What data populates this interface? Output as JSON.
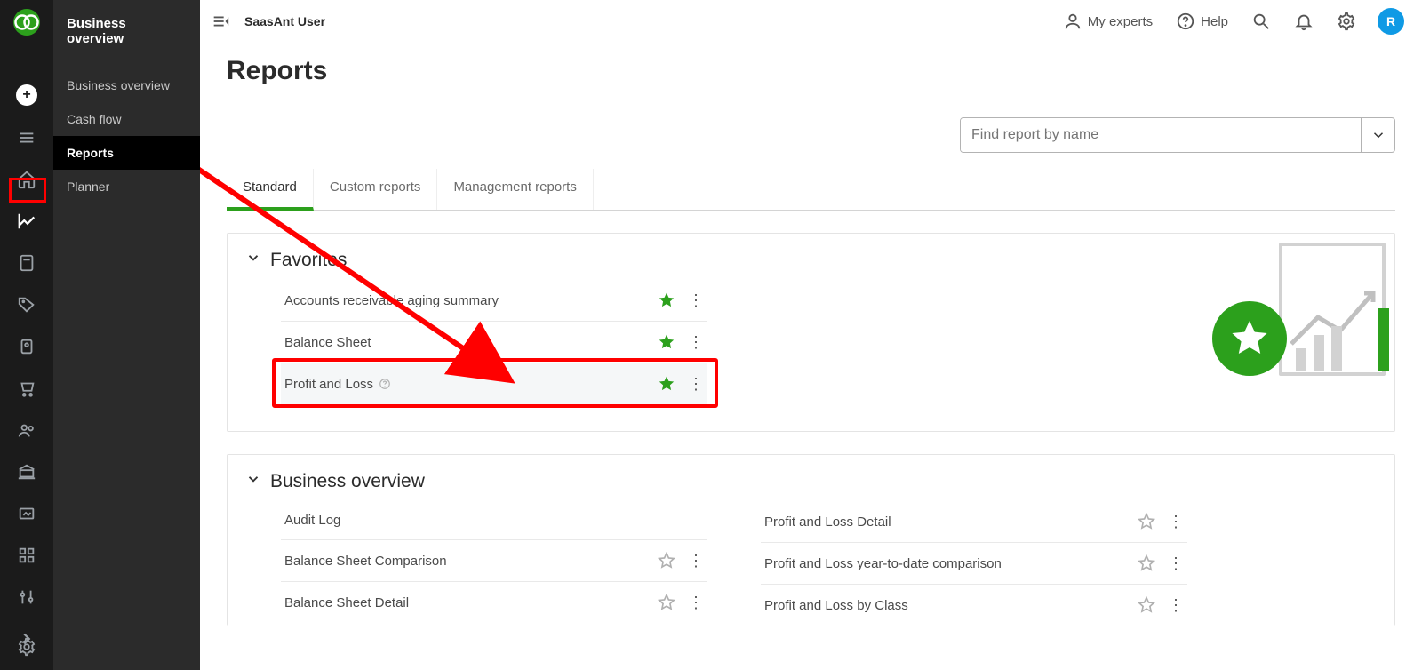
{
  "app": {
    "user": "SaasAnt User",
    "logo_letter": "qb",
    "avatar_letter": "R"
  },
  "topbar": {
    "my_experts": "My experts",
    "help": "Help"
  },
  "submenu": {
    "title": "Business overview",
    "items": [
      {
        "label": "Business overview",
        "active": false
      },
      {
        "label": "Cash flow",
        "active": false
      },
      {
        "label": "Reports",
        "active": true
      },
      {
        "label": "Planner",
        "active": false
      }
    ]
  },
  "page": {
    "title": "Reports",
    "search_placeholder": "Find report by name"
  },
  "tabs": [
    {
      "label": "Standard",
      "active": true
    },
    {
      "label": "Custom reports",
      "active": false
    },
    {
      "label": "Management reports",
      "active": false
    }
  ],
  "sections": {
    "favorites": {
      "title": "Favorites",
      "rows": [
        {
          "name": "Accounts receivable aging summary",
          "starred": true
        },
        {
          "name": "Balance Sheet",
          "starred": true
        },
        {
          "name": "Profit and Loss",
          "starred": true,
          "highlighted": true
        }
      ]
    },
    "business_overview": {
      "title": "Business overview",
      "left": [
        {
          "name": "Audit Log"
        },
        {
          "name": "Balance Sheet Comparison"
        },
        {
          "name": "Balance Sheet Detail"
        }
      ],
      "right": [
        {
          "name": "Profit and Loss Detail"
        },
        {
          "name": "Profit and Loss year-to-date comparison"
        },
        {
          "name": "Profit and Loss by Class"
        }
      ]
    }
  },
  "colors": {
    "accent": "#2ca01c",
    "highlight": "#ff0000"
  }
}
